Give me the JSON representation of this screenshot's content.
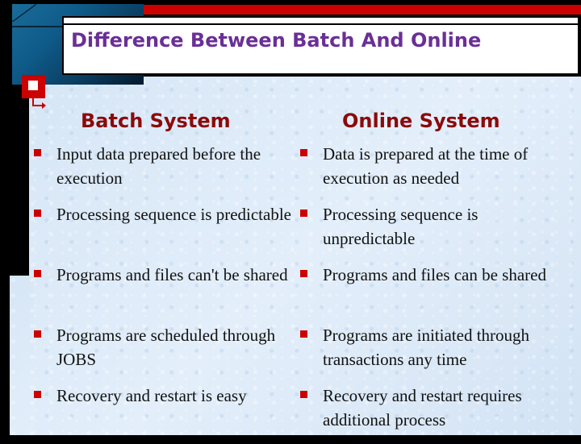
{
  "slide": {
    "title": "Difference Between Batch And Online",
    "colors": {
      "title": "#6a2f96",
      "heading": "#8b0a0a",
      "bullet": "#cc0000",
      "accent_bar": "#cc0000",
      "background": "#dbe9f7"
    }
  },
  "columns": [
    {
      "heading": "Batch System",
      "items": [
        "Input data prepared before the execution",
        "Processing sequence is predictable",
        "Programs and files can't be shared",
        "Programs are scheduled through JOBS",
        "Recovery and restart is easy"
      ]
    },
    {
      "heading": "Online System",
      "items": [
        "Data is prepared at the time of execution as needed",
        "Processing sequence is unpredictable",
        "Programs and files can be shared",
        "Programs are initiated through transactions any time",
        "Recovery and restart requires additional process"
      ]
    }
  ],
  "icons": {
    "marker": "red-square-marker-icon",
    "arrow": "elbow-arrow-icon",
    "bullet": "square-bullet-icon"
  }
}
